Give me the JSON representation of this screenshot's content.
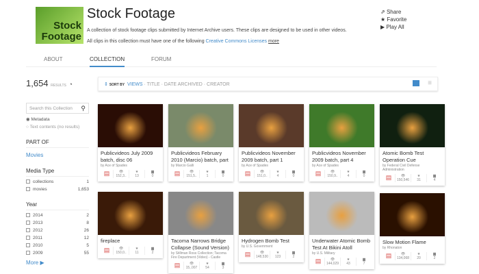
{
  "header": {
    "logo_text": "Stock Footage",
    "title": "Stock Footage",
    "description": "A collection of stock footage clips submitted by Internet Archive users. These clips are designed to be used in other videos.",
    "description2": "All clips in this collection must have one of the following",
    "license_link": "Creative Commons Licenses",
    "more": "more"
  },
  "actions": {
    "share": "Share",
    "favorite": "Favorite",
    "play_all": "Play All"
  },
  "tabs": [
    "ABOUT",
    "COLLECTION",
    "FORUM"
  ],
  "results": {
    "count": "1,654",
    "label": "RESULTS"
  },
  "sort": {
    "label": "SORT BY",
    "options": [
      "VIEWS",
      "TITLE",
      "DATE ARCHIVED",
      "CREATOR"
    ]
  },
  "sidebar": {
    "search_placeholder": "Search this Collection",
    "radio_metadata": "Metadata",
    "radio_text": "Text contents (no results)",
    "part_of": "PART OF",
    "part_of_link": "Movies",
    "media_type": "Media Type",
    "media": [
      {
        "label": "collections",
        "count": "1"
      },
      {
        "label": "movies",
        "count": "1,653"
      }
    ],
    "year": "Year",
    "years": [
      {
        "label": "2014",
        "count": "2"
      },
      {
        "label": "2013",
        "count": "8"
      },
      {
        "label": "2012",
        "count": "26"
      },
      {
        "label": "2011",
        "count": "12"
      },
      {
        "label": "2010",
        "count": "5"
      },
      {
        "label": "2009",
        "count": "55"
      }
    ],
    "more": "More"
  },
  "cards": [
    {
      "title": "Publicvideos July 2009 batch, disc 06",
      "by": "by Ace of Spades",
      "views": "152,3..",
      "favs": "13",
      "comments": "0",
      "color": "#2a0d05"
    },
    {
      "title": "Publicvideos February 2010 (Marcio) batch, part",
      "by": "by Marcio Galli",
      "views": "151,5..",
      "favs": "1",
      "comments": "0",
      "color": "#7a8a6a"
    },
    {
      "title": "Publicvideos November 2009 batch, part 1",
      "by": "by Ace of Spades",
      "views": "151,0..",
      "favs": "4",
      "comments": "0",
      "color": "#5a3a2a"
    },
    {
      "title": "Publicvideos November 2009 batch, part 4",
      "by": "by Ace of Spades",
      "views": "150,9..",
      "favs": "4",
      "comments": "0",
      "color": "#3f7a2a"
    },
    {
      "title": "Atomic Bomb Test Operation Cue",
      "by": "by Federal Civil Defense Administration",
      "views": "150,546",
      "favs": "31",
      "comments": "4",
      "color": "#102010"
    },
    {
      "title": "fireplace",
      "by": "",
      "views": "150,0..",
      "favs": "11",
      "comments": "2",
      "color": "#3a1a08"
    },
    {
      "title": "Tacoma Narrows Bridge Collapse (Sound Version)",
      "by": "by Stillman Ross Collection; Tacoma Fire Department (Video) - Castle",
      "views": "15,.007",
      "favs": "54",
      "comments": "3",
      "color": "#888"
    },
    {
      "title": "Hydrogen Bomb Test",
      "by": "by U.S. Government",
      "views": "148,530",
      "favs": "123",
      "comments": "2",
      "color": "#6a5a40"
    },
    {
      "title": "Underwater Atomic Bomb Test At Bikini Atoll",
      "by": "by U.S. Military",
      "views": "144,029",
      "favs": "43",
      "comments": "7",
      "color": "#bbb"
    },
    {
      "title": "Slow Motion Flame",
      "by": "by Rhonaton",
      "views": "134,068",
      "favs": "20",
      "comments": "2",
      "color": "#2a1000"
    }
  ]
}
